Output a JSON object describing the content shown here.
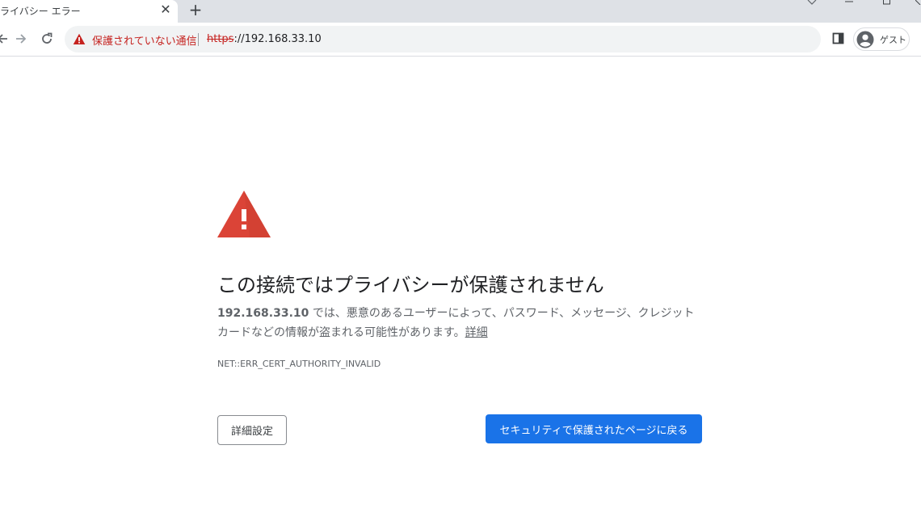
{
  "tab": {
    "title": "ライバシー エラー",
    "close_glyph": "✕",
    "new_tab_glyph": "+"
  },
  "toolbar": {
    "security_warning_text": "保護されていない通信",
    "url_scheme": "https",
    "url_rest": "://192.168.33.10",
    "profile_label": "ゲスト"
  },
  "page": {
    "heading": "この接続ではプライバシーが保護されません",
    "host": "192.168.33.10",
    "explanation_text": " では、悪意のあるユーザーによって、パスワード、メッセージ、クレジット カードなどの情報が盗まれる可能性があります。",
    "learn_more": "詳細",
    "error_code": "NET::ERR_CERT_AUTHORITY_INVALID",
    "advanced_button": "詳細設定",
    "back_button": "セキュリティで保護されたページに戻る"
  },
  "colors": {
    "accent_blue": "#1a73e8",
    "warning_red": "#c5221f",
    "big_warning_red": "#db4437"
  },
  "icons": [
    "close-icon",
    "plus-icon",
    "back-arrow-icon",
    "forward-arrow-icon",
    "reload-icon",
    "warning-triangle-icon",
    "side-panel-icon",
    "account-circle-icon",
    "large-warning-triangle-icon"
  ]
}
